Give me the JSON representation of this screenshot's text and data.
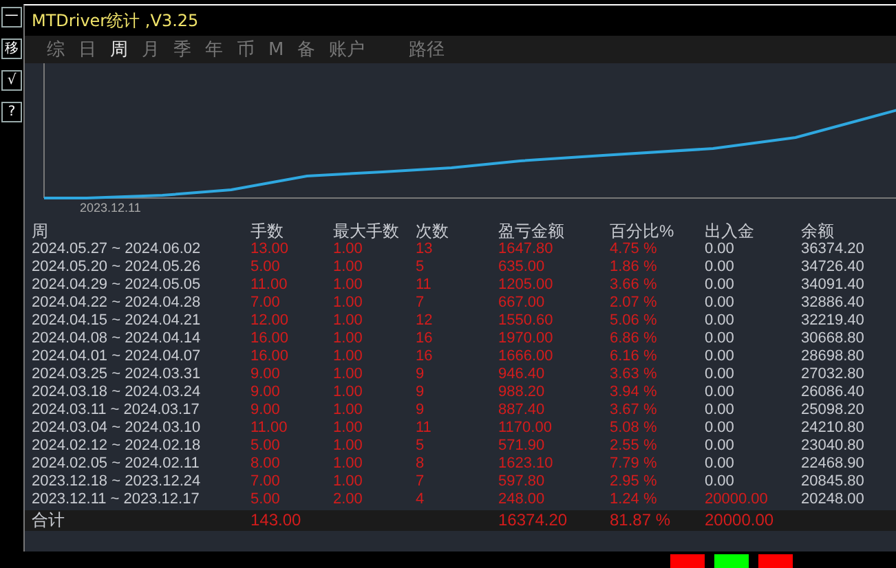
{
  "side_buttons": [
    "一",
    "移",
    "√",
    "?"
  ],
  "window": {
    "title": "MTDriver统计 ,V3.25"
  },
  "tabs": [
    {
      "label": "综",
      "selected": false
    },
    {
      "label": "日",
      "selected": false
    },
    {
      "label": "周",
      "selected": true
    },
    {
      "label": "月",
      "selected": false
    },
    {
      "label": "季",
      "selected": false
    },
    {
      "label": "年",
      "selected": false
    },
    {
      "label": "币",
      "selected": false
    },
    {
      "label": "M",
      "selected": false
    },
    {
      "label": "备",
      "selected": false
    },
    {
      "label": "账户",
      "selected": false
    },
    {
      "label": "路径",
      "selected": false
    }
  ],
  "chart": {
    "x_label": "2023.12.11"
  },
  "table": {
    "columns": [
      {
        "label": "周",
        "kind": "period"
      },
      {
        "label": "手数",
        "kind": "trade"
      },
      {
        "label": "最大手数",
        "kind": "trade"
      },
      {
        "label": "次数",
        "kind": "trade"
      },
      {
        "label": "盈亏金额",
        "kind": "trade"
      },
      {
        "label": "百分比%",
        "kind": "trade"
      },
      {
        "label": "出入金",
        "kind": "cash"
      },
      {
        "label": "余额",
        "kind": "balance"
      }
    ],
    "rows": [
      {
        "cells": [
          "2024.05.27 ~ 2024.06.02",
          "13.00",
          "1.00",
          "13",
          "1647.80",
          "4.75 %",
          "0.00",
          "36374.20"
        ],
        "deposit_red": false
      },
      {
        "cells": [
          "2024.05.20 ~ 2024.05.26",
          "5.00",
          "1.00",
          "5",
          "635.00",
          "1.86 %",
          "0.00",
          "34726.40"
        ],
        "deposit_red": false
      },
      {
        "cells": [
          "2024.04.29 ~ 2024.05.05",
          "11.00",
          "1.00",
          "11",
          "1205.00",
          "3.66 %",
          "0.00",
          "34091.40"
        ],
        "deposit_red": false
      },
      {
        "cells": [
          "2024.04.22 ~ 2024.04.28",
          "7.00",
          "1.00",
          "7",
          "667.00",
          "2.07 %",
          "0.00",
          "32886.40"
        ],
        "deposit_red": false
      },
      {
        "cells": [
          "2024.04.15 ~ 2024.04.21",
          "12.00",
          "1.00",
          "12",
          "1550.60",
          "5.06 %",
          "0.00",
          "32219.40"
        ],
        "deposit_red": false
      },
      {
        "cells": [
          "2024.04.08 ~ 2024.04.14",
          "16.00",
          "1.00",
          "16",
          "1970.00",
          "6.86 %",
          "0.00",
          "30668.80"
        ],
        "deposit_red": false
      },
      {
        "cells": [
          "2024.04.01 ~ 2024.04.07",
          "16.00",
          "1.00",
          "16",
          "1666.00",
          "6.16 %",
          "0.00",
          "28698.80"
        ],
        "deposit_red": false
      },
      {
        "cells": [
          "2024.03.25 ~ 2024.03.31",
          "9.00",
          "1.00",
          "9",
          "946.40",
          "3.63 %",
          "0.00",
          "27032.80"
        ],
        "deposit_red": false
      },
      {
        "cells": [
          "2024.03.18 ~ 2024.03.24",
          "9.00",
          "1.00",
          "9",
          "988.20",
          "3.94 %",
          "0.00",
          "26086.40"
        ],
        "deposit_red": false
      },
      {
        "cells": [
          "2024.03.11 ~ 2024.03.17",
          "9.00",
          "1.00",
          "9",
          "887.40",
          "3.67 %",
          "0.00",
          "25098.20"
        ],
        "deposit_red": false
      },
      {
        "cells": [
          "2024.03.04 ~ 2024.03.10",
          "11.00",
          "1.00",
          "11",
          "1170.00",
          "5.08 %",
          "0.00",
          "24210.80"
        ],
        "deposit_red": false
      },
      {
        "cells": [
          "2024.02.12 ~ 2024.02.18",
          "5.00",
          "1.00",
          "5",
          "571.90",
          "2.55 %",
          "0.00",
          "23040.80"
        ],
        "deposit_red": false
      },
      {
        "cells": [
          "2024.02.05 ~ 2024.02.11",
          "8.00",
          "1.00",
          "8",
          "1623.10",
          "7.79 %",
          "0.00",
          "22468.90"
        ],
        "deposit_red": false
      },
      {
        "cells": [
          "2023.12.18 ~ 2023.12.24",
          "7.00",
          "1.00",
          "7",
          "597.80",
          "2.95 %",
          "0.00",
          "20845.80"
        ],
        "deposit_red": false
      },
      {
        "cells": [
          "2023.12.11 ~ 2023.12.17",
          "5.00",
          "2.00",
          "4",
          "248.00",
          "1.24 %",
          "20000.00",
          "20248.00"
        ],
        "deposit_red": true
      }
    ],
    "total": {
      "label": "合计",
      "lots": "143.00",
      "profit": "16374.20",
      "percent": "81.87 %",
      "deposit": "20000.00"
    }
  },
  "bottom_bars": [
    {
      "color": "#ff0000"
    },
    {
      "color": "#00ff00"
    },
    {
      "color": "#ff0000"
    }
  ]
}
